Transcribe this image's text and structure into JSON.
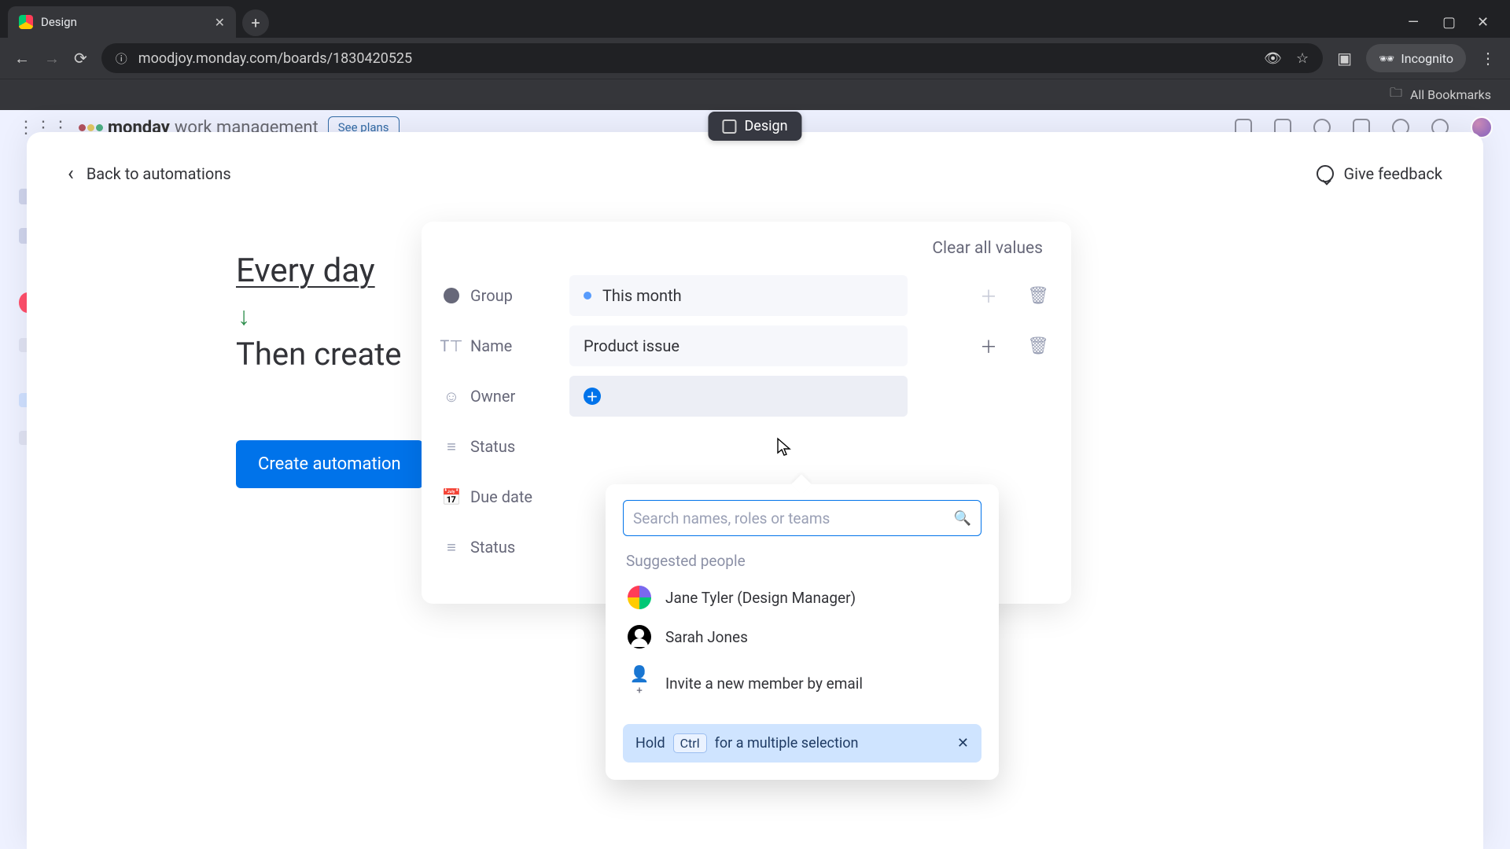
{
  "browser": {
    "tab_title": "Design",
    "new_tab_glyph": "+",
    "window_controls": {
      "min": "—",
      "max": "▢",
      "close": "✕"
    },
    "url": "moodjoy.monday.com/boards/1830420525",
    "incognito_label": "Incognito",
    "all_bookmarks": "All Bookmarks"
  },
  "monday_header": {
    "brand": "monday",
    "subbrand": "work management",
    "see_plans": "See plans"
  },
  "content_badge": {
    "title": "Design"
  },
  "sheet": {
    "back_label": "Back to automations",
    "feedback_label": "Give feedback"
  },
  "automation": {
    "trigger_label": "Every day",
    "arrow_glyph": "↓",
    "then_label": "Then create",
    "create_button": "Create automation"
  },
  "card": {
    "clear_label": "Clear all values",
    "rows": {
      "group": {
        "label": "Group",
        "value": "This month"
      },
      "name": {
        "label": "Name",
        "value": "Product issue"
      },
      "owner": {
        "label": "Owner",
        "value": ""
      },
      "status": {
        "label": "Status",
        "value": ""
      },
      "due": {
        "label": "Due date",
        "value": ""
      },
      "status2": {
        "label": "Status",
        "value": ""
      }
    },
    "add_glyph": "＋",
    "trash_glyph": "🗑"
  },
  "dropdown": {
    "search_placeholder": "Search names, roles or teams",
    "suggested_header": "Suggested people",
    "people": [
      {
        "name": "Jane Tyler (Design Manager)"
      },
      {
        "name": "Sarah Jones"
      }
    ],
    "invite_label": "Invite a new member by email",
    "hint_pre": "Hold",
    "hint_key": "Ctrl",
    "hint_post": "for a multiple selection",
    "hint_close": "✕"
  }
}
